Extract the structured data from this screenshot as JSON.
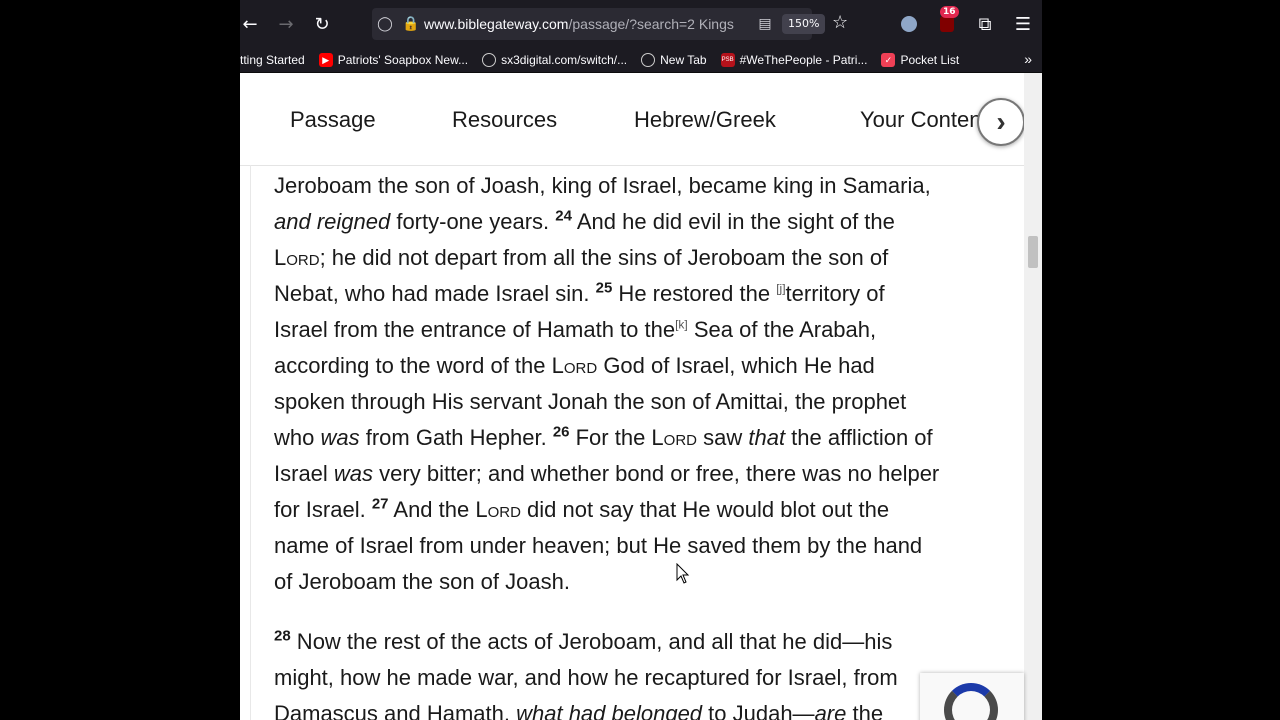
{
  "toolbar": {
    "url_domain": "www.biblegateway.com",
    "url_rest": "/passage/?search=2 Kings",
    "zoom": "150%",
    "badge_count": "16"
  },
  "bookmarks": [
    {
      "label": "tting Started",
      "icon": "globe-icon",
      "color": "#1c1b22"
    },
    {
      "label": "Patriots' Soapbox New...",
      "icon": "youtube-icon",
      "color": "#ff0000"
    },
    {
      "label": "sx3digital.com/switch/...",
      "icon": "globe-icon",
      "color": "#1c1b22"
    },
    {
      "label": "New Tab",
      "icon": "globe-icon",
      "color": "#1c1b22"
    },
    {
      "label": "#WeThePeople - Patri...",
      "icon": "psb-icon",
      "color": "#b5121b"
    },
    {
      "label": "Pocket List",
      "icon": "pocket-icon",
      "color": "#ef4056"
    }
  ],
  "nav": {
    "passage": "Passage",
    "resources": "Resources",
    "hebrew_greek": "Hebrew/Greek",
    "your_content": "Your Conten"
  },
  "text": {
    "l1": "Jeroboam the son of Joash, king of Israel, became king in Samaria,",
    "l2a": "and reigned",
    "l2b": " forty-one years. ",
    "v24": "24",
    "l2c": " And he did evil in the sight of the",
    "lord": "Lord",
    "l3b": "; he did not depart from all the sins of Jeroboam the son of",
    "l4a": "Nebat, who had made Israel sin. ",
    "v25": "25",
    "l4b": " He restored the ",
    "fn_j": "[j]",
    "l4c": "territory of",
    "l5a": "Israel from the entrance of Hamath to the",
    "fn_k": "[k]",
    "l5b": " Sea of the Arabah,",
    "l6a": "according to the word of the ",
    "l6b": " God of Israel, which He had",
    "l7": "spoken through His servant Jonah the son of Amittai, the prophet",
    "l8a": "who ",
    "was": "was",
    "l8b": " from Gath Hepher. ",
    "v26": "26",
    "l8c": " For the ",
    "l8d": " saw ",
    "that": "that",
    "l8e": " the affliction of",
    "l9a": "Israel ",
    "l9b": " very bitter; and whether bond or free, there was no helper",
    "l10a": "for Israel. ",
    "v27": "27",
    "l10b": " And the ",
    "l10c": " did not say that He would blot out the",
    "l11": "name of Israel from under heaven; but He saved them by the hand",
    "l12": "of Jeroboam the son of Joash.",
    "v28": "28",
    "l13": " Now the rest of the acts of Jeroboam, and all that he did—his",
    "l14": "might, how he made war, and how he recaptured for Israel, from",
    "l15a": "Damascus and Hamath, ",
    "l15b": "what had belonged",
    "l15c": " to Judah—",
    "are": "are",
    "l15d": " the"
  }
}
